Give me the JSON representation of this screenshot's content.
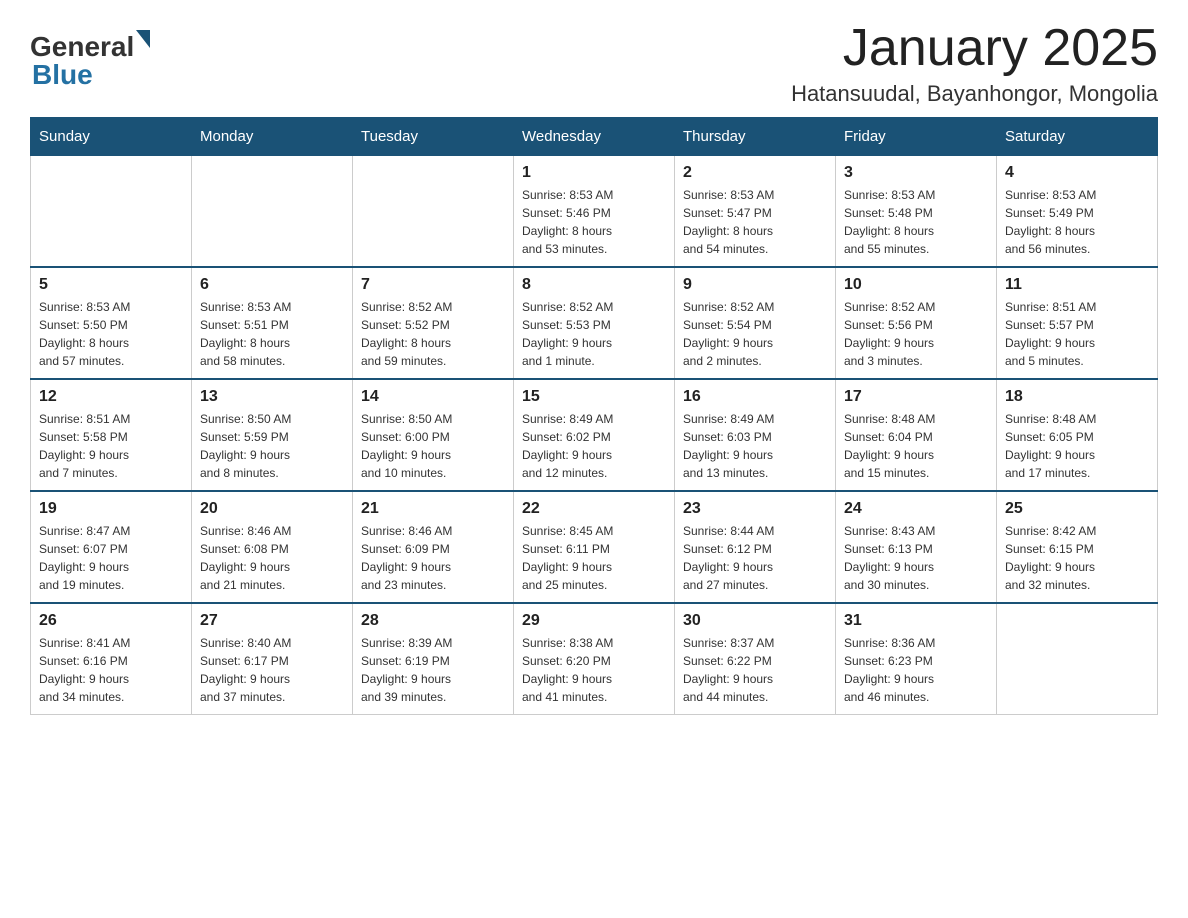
{
  "header": {
    "logo_general": "General",
    "logo_blue": "Blue",
    "month_title": "January 2025",
    "location": "Hatansuudal, Bayanhongor, Mongolia"
  },
  "days_of_week": [
    "Sunday",
    "Monday",
    "Tuesday",
    "Wednesday",
    "Thursday",
    "Friday",
    "Saturday"
  ],
  "weeks": [
    [
      {
        "day": "",
        "info": ""
      },
      {
        "day": "",
        "info": ""
      },
      {
        "day": "",
        "info": ""
      },
      {
        "day": "1",
        "info": "Sunrise: 8:53 AM\nSunset: 5:46 PM\nDaylight: 8 hours\nand 53 minutes."
      },
      {
        "day": "2",
        "info": "Sunrise: 8:53 AM\nSunset: 5:47 PM\nDaylight: 8 hours\nand 54 minutes."
      },
      {
        "day": "3",
        "info": "Sunrise: 8:53 AM\nSunset: 5:48 PM\nDaylight: 8 hours\nand 55 minutes."
      },
      {
        "day": "4",
        "info": "Sunrise: 8:53 AM\nSunset: 5:49 PM\nDaylight: 8 hours\nand 56 minutes."
      }
    ],
    [
      {
        "day": "5",
        "info": "Sunrise: 8:53 AM\nSunset: 5:50 PM\nDaylight: 8 hours\nand 57 minutes."
      },
      {
        "day": "6",
        "info": "Sunrise: 8:53 AM\nSunset: 5:51 PM\nDaylight: 8 hours\nand 58 minutes."
      },
      {
        "day": "7",
        "info": "Sunrise: 8:52 AM\nSunset: 5:52 PM\nDaylight: 8 hours\nand 59 minutes."
      },
      {
        "day": "8",
        "info": "Sunrise: 8:52 AM\nSunset: 5:53 PM\nDaylight: 9 hours\nand 1 minute."
      },
      {
        "day": "9",
        "info": "Sunrise: 8:52 AM\nSunset: 5:54 PM\nDaylight: 9 hours\nand 2 minutes."
      },
      {
        "day": "10",
        "info": "Sunrise: 8:52 AM\nSunset: 5:56 PM\nDaylight: 9 hours\nand 3 minutes."
      },
      {
        "day": "11",
        "info": "Sunrise: 8:51 AM\nSunset: 5:57 PM\nDaylight: 9 hours\nand 5 minutes."
      }
    ],
    [
      {
        "day": "12",
        "info": "Sunrise: 8:51 AM\nSunset: 5:58 PM\nDaylight: 9 hours\nand 7 minutes."
      },
      {
        "day": "13",
        "info": "Sunrise: 8:50 AM\nSunset: 5:59 PM\nDaylight: 9 hours\nand 8 minutes."
      },
      {
        "day": "14",
        "info": "Sunrise: 8:50 AM\nSunset: 6:00 PM\nDaylight: 9 hours\nand 10 minutes."
      },
      {
        "day": "15",
        "info": "Sunrise: 8:49 AM\nSunset: 6:02 PM\nDaylight: 9 hours\nand 12 minutes."
      },
      {
        "day": "16",
        "info": "Sunrise: 8:49 AM\nSunset: 6:03 PM\nDaylight: 9 hours\nand 13 minutes."
      },
      {
        "day": "17",
        "info": "Sunrise: 8:48 AM\nSunset: 6:04 PM\nDaylight: 9 hours\nand 15 minutes."
      },
      {
        "day": "18",
        "info": "Sunrise: 8:48 AM\nSunset: 6:05 PM\nDaylight: 9 hours\nand 17 minutes."
      }
    ],
    [
      {
        "day": "19",
        "info": "Sunrise: 8:47 AM\nSunset: 6:07 PM\nDaylight: 9 hours\nand 19 minutes."
      },
      {
        "day": "20",
        "info": "Sunrise: 8:46 AM\nSunset: 6:08 PM\nDaylight: 9 hours\nand 21 minutes."
      },
      {
        "day": "21",
        "info": "Sunrise: 8:46 AM\nSunset: 6:09 PM\nDaylight: 9 hours\nand 23 minutes."
      },
      {
        "day": "22",
        "info": "Sunrise: 8:45 AM\nSunset: 6:11 PM\nDaylight: 9 hours\nand 25 minutes."
      },
      {
        "day": "23",
        "info": "Sunrise: 8:44 AM\nSunset: 6:12 PM\nDaylight: 9 hours\nand 27 minutes."
      },
      {
        "day": "24",
        "info": "Sunrise: 8:43 AM\nSunset: 6:13 PM\nDaylight: 9 hours\nand 30 minutes."
      },
      {
        "day": "25",
        "info": "Sunrise: 8:42 AM\nSunset: 6:15 PM\nDaylight: 9 hours\nand 32 minutes."
      }
    ],
    [
      {
        "day": "26",
        "info": "Sunrise: 8:41 AM\nSunset: 6:16 PM\nDaylight: 9 hours\nand 34 minutes."
      },
      {
        "day": "27",
        "info": "Sunrise: 8:40 AM\nSunset: 6:17 PM\nDaylight: 9 hours\nand 37 minutes."
      },
      {
        "day": "28",
        "info": "Sunrise: 8:39 AM\nSunset: 6:19 PM\nDaylight: 9 hours\nand 39 minutes."
      },
      {
        "day": "29",
        "info": "Sunrise: 8:38 AM\nSunset: 6:20 PM\nDaylight: 9 hours\nand 41 minutes."
      },
      {
        "day": "30",
        "info": "Sunrise: 8:37 AM\nSunset: 6:22 PM\nDaylight: 9 hours\nand 44 minutes."
      },
      {
        "day": "31",
        "info": "Sunrise: 8:36 AM\nSunset: 6:23 PM\nDaylight: 9 hours\nand 46 minutes."
      },
      {
        "day": "",
        "info": ""
      }
    ]
  ]
}
